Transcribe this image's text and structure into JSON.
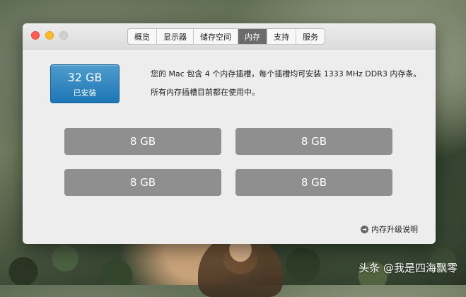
{
  "window": {
    "traffic_lights": {
      "close": "close-button",
      "minimize": "minimize-button",
      "zoom": "zoom-button"
    },
    "tabs": [
      "概览",
      "显示器",
      "储存空间",
      "内存",
      "支持",
      "服务"
    ],
    "active_tab": "内存"
  },
  "memory": {
    "installed_size": "32 GB",
    "installed_label": "已安装",
    "description_1": "您的 Mac 包含 4 个内存插槽，每个插槽均可安装 1333 MHz DDR3 内存条。",
    "description_2": "所有内存插槽目前都在使用中。",
    "slots": [
      "8 GB",
      "8 GB",
      "8 GB",
      "8 GB"
    ],
    "help_link": "内存升级说明"
  },
  "watermark": "头条 @我是四海飘零",
  "colors": {
    "accent_blue": "#2f7dbd",
    "slot_gray": "#8f8f8f",
    "active_tab_gray": "#6b6b6b"
  }
}
